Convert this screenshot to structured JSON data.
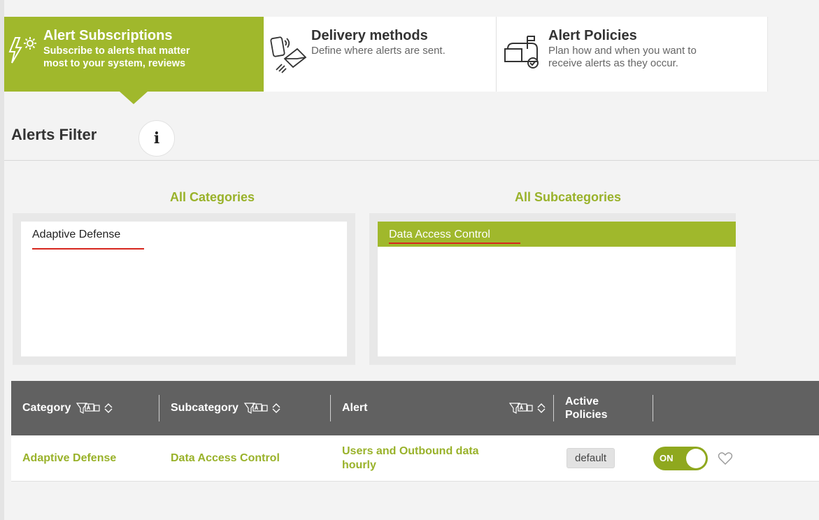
{
  "tabs": [
    {
      "title": "Alert Subscriptions",
      "subtitle_line1": "Subscribe to alerts that matter",
      "subtitle_line2": "most to your system, reviews",
      "icon": "lightning-gear-icon",
      "active": true
    },
    {
      "title": "Delivery methods",
      "subtitle_line1": "Define where alerts are sent.",
      "icon": "phone-envelope-icon",
      "active": false
    },
    {
      "title": "Alert Policies",
      "subtitle_line1": "Plan how and when you want to",
      "subtitle_line2": "receive alerts as they occur.",
      "icon": "mailbox-check-icon",
      "active": false
    }
  ],
  "filter": {
    "title": "Alerts Filter",
    "info_glyph": "i",
    "categories_heading": "All Categories",
    "subcategories_heading": "All Subcategories",
    "categories": [
      "Adaptive Defense"
    ],
    "subcategories": [
      "Data Access Control"
    ]
  },
  "table": {
    "headers": {
      "category": "Category",
      "subcategory": "Subcategory",
      "alert": "Alert",
      "policies_line1": "Active",
      "policies_line2": "Policies"
    },
    "rows": [
      {
        "category": "Adaptive Defense",
        "subcategory": "Data Access Control",
        "alert_line1": "Users and Outbound data",
        "alert_line2": "hourly",
        "policy": "default",
        "toggle": "ON"
      }
    ]
  },
  "colors": {
    "accent": "#a0b82c",
    "accent_text": "#99b22a",
    "header_bg": "#616161",
    "underline_red": "#d7261e"
  }
}
